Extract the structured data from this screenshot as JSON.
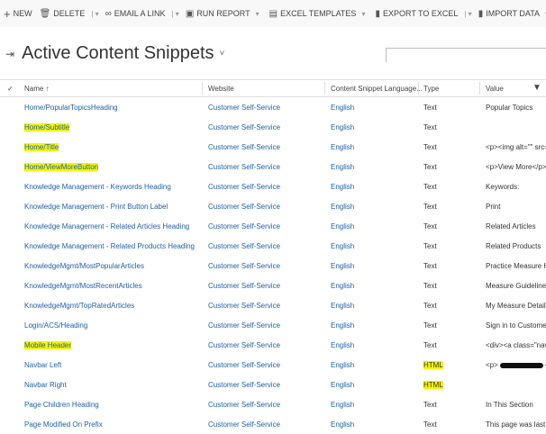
{
  "toolbar": {
    "new": "NEW",
    "delete": "DELETE",
    "email": "EMAIL A LINK",
    "run_report": "RUN REPORT",
    "excel_templates": "EXCEL TEMPLATES",
    "export": "EXPORT TO EXCEL",
    "import": "IMPORT DATA"
  },
  "view": {
    "title": "Active Content Snippets"
  },
  "search": {
    "value": ""
  },
  "columns": {
    "name": "Name ↑",
    "website": "Website",
    "language": "Content Snippet Language...",
    "type": "Type",
    "value": "Value"
  },
  "rows": [
    {
      "name": "Home/PopularTopicsHeading",
      "website": "Customer Self-Service",
      "language": "English",
      "type": "Text",
      "value": "Popular Topics"
    },
    {
      "name": "Home/Subtitle",
      "website": "Customer Self-Service",
      "language": "English",
      "type": "Text",
      "value": ""
    },
    {
      "name": "Home/Title",
      "website": "Customer Self-Service",
      "language": "English",
      "type": "Text",
      "value": "<p><img alt=\"\" src="
    },
    {
      "name": "Home/ViewMoreButton",
      "website": "Customer Self-Service",
      "language": "English",
      "type": "Text",
      "value": "<p>View More</p>"
    },
    {
      "name": "Knowledge Management - Keywords Heading",
      "website": "Customer Self-Service",
      "language": "English",
      "type": "Text",
      "value": "Keywords:"
    },
    {
      "name": "Knowledge Management - Print Button Label",
      "website": "Customer Self-Service",
      "language": "English",
      "type": "Text",
      "value": "Print"
    },
    {
      "name": "Knowledge Management - Related Articles Heading",
      "website": "Customer Self-Service",
      "language": "English",
      "type": "Text",
      "value": "Related Articles"
    },
    {
      "name": "Knowledge Management - Related Products Heading",
      "website": "Customer Self-Service",
      "language": "English",
      "type": "Text",
      "value": "Related Products"
    },
    {
      "name": "KnowledgeMgmt/MostPopularArticles",
      "website": "Customer Self-Service",
      "language": "English",
      "type": "Text",
      "value": "Practice Measure His"
    },
    {
      "name": "KnowledgeMgmt/MostRecentArticles",
      "website": "Customer Self-Service",
      "language": "English",
      "type": "Text",
      "value": "Measure Guidelines"
    },
    {
      "name": "KnowledgeMgmt/TopRatedArticles",
      "website": "Customer Self-Service",
      "language": "English",
      "type": "Text",
      "value": "My Measure Details"
    },
    {
      "name": "Login/ACS/Heading",
      "website": "Customer Self-Service",
      "language": "English",
      "type": "Text",
      "value": "Sign in to Customer"
    },
    {
      "name": "Mobile Header",
      "website": "Customer Self-Service",
      "language": "English",
      "type": "Text",
      "value": "<div><a class=\"navl"
    },
    {
      "name": "Navbar Left",
      "website": "Customer Self-Service",
      "language": "English",
      "type": "HTML",
      "value": "<p>",
      "value_tail": "</p"
    },
    {
      "name": "Navbar Right",
      "website": "Customer Self-Service",
      "language": "English",
      "type": "HTML",
      "value": ""
    },
    {
      "name": "Page Children Heading",
      "website": "Customer Self-Service",
      "language": "English",
      "type": "Text",
      "value": "In This Section"
    },
    {
      "name": "Page Modified On Prefix",
      "website": "Customer Self-Service",
      "language": "English",
      "type": "Text",
      "value": "This page was last up"
    }
  ],
  "highlighted_names": [
    1,
    2,
    3,
    12
  ],
  "highlighted_types": [
    13,
    14
  ]
}
